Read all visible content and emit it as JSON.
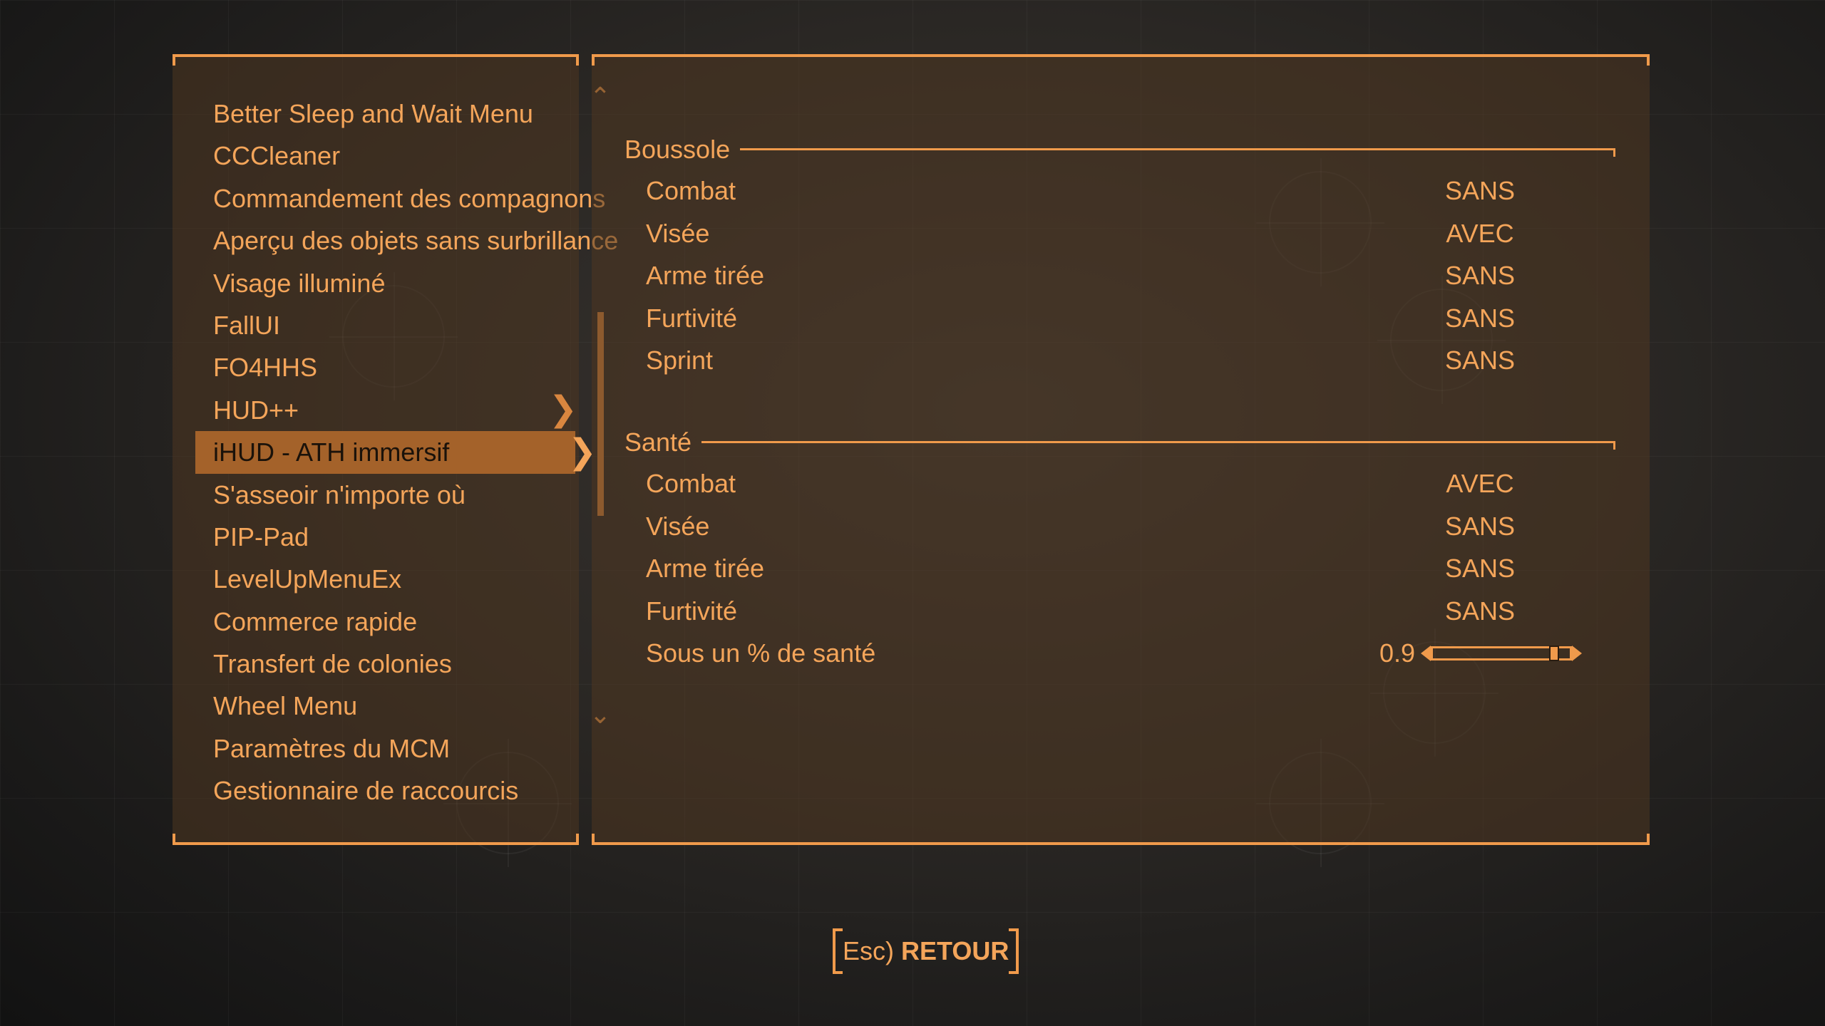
{
  "colors": {
    "accent": "#f09a4b",
    "text": "#f4a55a",
    "selected_bg": "#a4622a",
    "panel_bg": "#4e3721"
  },
  "scroll": {
    "up_icon": "chevron-up-icon",
    "down_icon": "chevron-down-icon"
  },
  "mods": [
    {
      "label": "Better Sleep and Wait Menu"
    },
    {
      "label": "CCCleaner"
    },
    {
      "label": "Commandement des compagnons"
    },
    {
      "label": "Aperçu des objets sans surbrillance"
    },
    {
      "label": "Visage illuminé"
    },
    {
      "label": "FallUI"
    },
    {
      "label": "FO4HHS"
    },
    {
      "label": "HUD++",
      "has_submenu": true
    },
    {
      "label": "iHUD - ATH immersif",
      "selected": true,
      "has_submenu": true
    },
    {
      "label": "S'asseoir n'importe où"
    },
    {
      "label": "PIP-Pad"
    },
    {
      "label": "LevelUpMenuEx"
    },
    {
      "label": "Commerce rapide"
    },
    {
      "label": "Transfert de colonies"
    },
    {
      "label": "Wheel Menu"
    },
    {
      "label": "Paramètres du MCM"
    },
    {
      "label": "Gestionnaire de raccourcis"
    }
  ],
  "settings": {
    "compass": {
      "title": "Boussole",
      "rows": [
        {
          "label": "Combat",
          "value": "SANS"
        },
        {
          "label": "Visée",
          "value": "AVEC"
        },
        {
          "label": "Arme tirée",
          "value": "SANS"
        },
        {
          "label": "Furtivité",
          "value": "SANS"
        },
        {
          "label": "Sprint",
          "value": "SANS"
        }
      ]
    },
    "health": {
      "title": "Santé",
      "rows": [
        {
          "label": "Combat",
          "value": "AVEC"
        },
        {
          "label": "Visée",
          "value": "SANS"
        },
        {
          "label": "Arme tirée",
          "value": "SANS"
        },
        {
          "label": "Furtivité",
          "value": "SANS"
        }
      ],
      "slider": {
        "label": "Sous un % de santé",
        "value_text": "0.9",
        "value": 0.9
      }
    }
  },
  "footer": {
    "back_key": "Esc)",
    "back_label": "RETOUR"
  }
}
